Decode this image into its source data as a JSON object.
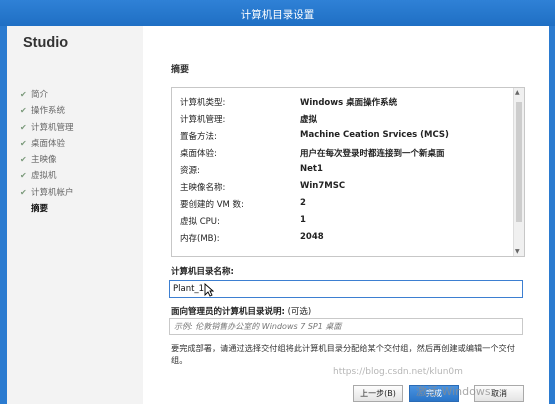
{
  "window": {
    "title": "计算机目录设置"
  },
  "sidebar": {
    "brand": "Studio",
    "steps": [
      {
        "label": "简介",
        "done": true
      },
      {
        "label": "操作系统",
        "done": true
      },
      {
        "label": "计算机管理",
        "done": true
      },
      {
        "label": "桌面体验",
        "done": true
      },
      {
        "label": "主映像",
        "done": true
      },
      {
        "label": "虚拟机",
        "done": true
      },
      {
        "label": "计算机帐户",
        "done": true
      },
      {
        "label": "摘要",
        "done": false,
        "current": true
      }
    ]
  },
  "main": {
    "heading": "摘要",
    "summary": [
      {
        "key": "计算机类型:",
        "value": "Windows 桌面操作系统"
      },
      {
        "key": "计算机管理:",
        "value": "虚拟"
      },
      {
        "key": "置备方法:",
        "value": "Machine Ceation Srvices (MCS)"
      },
      {
        "key": "桌面体验:",
        "value": "用户在每次登录时都连接到一个新桌面"
      },
      {
        "key": "资源:",
        "value": "Net1"
      },
      {
        "key": "主映像名称:",
        "value": "Win7MSC"
      },
      {
        "key": "要创建的 VM 数:",
        "value": "2"
      },
      {
        "key": "虚拟 CPU:",
        "value": "1"
      },
      {
        "key": "内存(MB):",
        "value": "2048"
      }
    ],
    "catalog_name_label": "计算机目录名称:",
    "catalog_name_value": "Plant_1",
    "description_label": "面向管理员的计算机目录说明:",
    "description_optional": "(可选)",
    "description_placeholder": "示例: 伦敦销售办公室的 Windows 7 SP1 桌面",
    "note": "要完成部署，请通过选择交付组将此计算机目录分配给某个交付组，然后再创建或编辑一个交付组。"
  },
  "buttons": {
    "back": "上一步(B)",
    "finish": "完成",
    "cancel": "取消"
  },
  "watermarks": {
    "url": "https://blog.csdn.net/klun0m",
    "activation": "激活 Windows"
  },
  "colors": {
    "titlebar": "#2f81d6",
    "accent": "#2a75c8",
    "check": "#7b9a7b"
  }
}
